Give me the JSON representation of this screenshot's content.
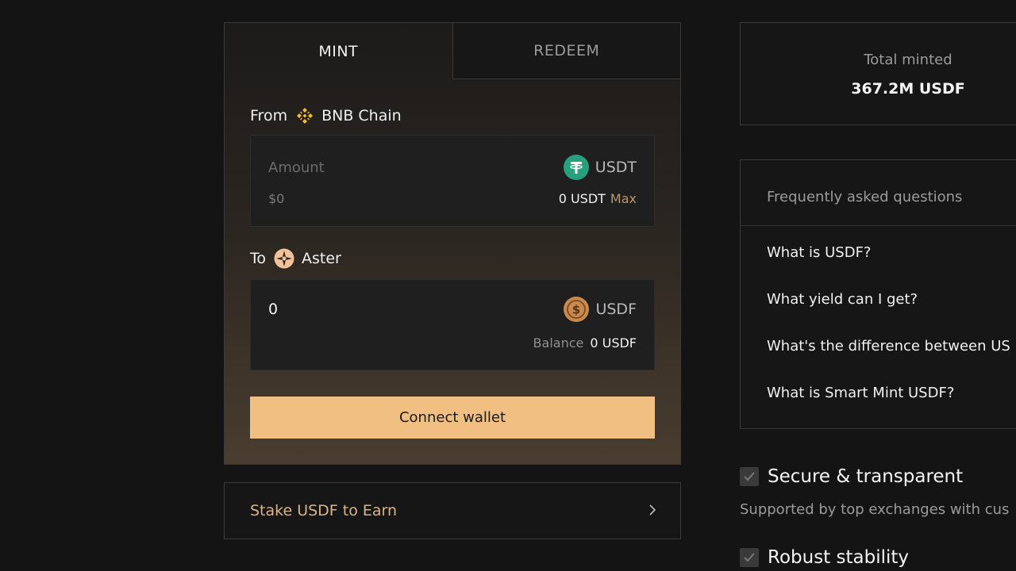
{
  "tabs": {
    "mint": "MINT",
    "redeem": "REDEEM"
  },
  "from": {
    "label": "From",
    "chain_icon": "bnb-chain-icon",
    "chain": "BNB Chain",
    "amount_placeholder": "Amount",
    "usd_value": "$0",
    "token": "USDT",
    "token_icon": "tether-icon",
    "balance": "0 USDT",
    "max": "Max"
  },
  "to": {
    "label": "To",
    "chain_icon": "aster-icon",
    "chain": "Aster",
    "amount": "0",
    "token": "USDF",
    "token_icon": "usdf-coin-icon",
    "balance_label": "Balance",
    "balance": "0 USDF"
  },
  "connect_button": "Connect wallet",
  "stake": {
    "label": "Stake USDF to Earn",
    "icon": "chevron-right-icon"
  },
  "stats": {
    "label": "Total minted",
    "value": "367.2M USDF"
  },
  "faq": {
    "title": "Frequently asked questions",
    "items": [
      "What is USDF?",
      "What yield can I get?",
      "What's the difference between US",
      "What is Smart Mint USDF?"
    ]
  },
  "features": [
    {
      "title": "Secure & transparent",
      "description": "Supported by top exchanges with cus"
    },
    {
      "title": "Robust stability"
    }
  ],
  "colors": {
    "accent": "#f2bf82",
    "stake_text": "#d9b48a",
    "background": "#141414"
  }
}
